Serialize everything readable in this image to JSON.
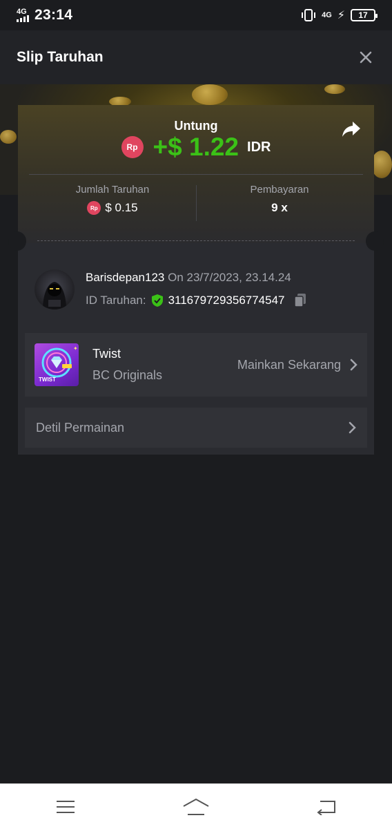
{
  "status_bar": {
    "network": "4G",
    "time": "23:14",
    "network_right": "4G",
    "battery": "17"
  },
  "header": {
    "title": "Slip Taruhan"
  },
  "slip": {
    "profit_label": "Untung",
    "currency_badge": "Rp",
    "profit_value": "+$ 1.22",
    "profit_currency": "IDR",
    "bet_amount_label": "Jumlah Taruhan",
    "bet_amount_value": "$ 0.15",
    "payout_label": "Pembayaran",
    "payout_value": "9 x",
    "profit_color": "#3bc117",
    "badge_color": "#e0455f"
  },
  "user": {
    "username": "Barisdepan123",
    "date": "On 23/7/2023, 23.14.24",
    "bet_id_label": "ID Taruhan:",
    "bet_id": "311679729356774547"
  },
  "game": {
    "name": "Twist",
    "provider": "BC Originals",
    "thumb_text": "TWIST",
    "play_label": "Mainkan Sekarang"
  },
  "details": {
    "label": "Detil Permainan"
  }
}
